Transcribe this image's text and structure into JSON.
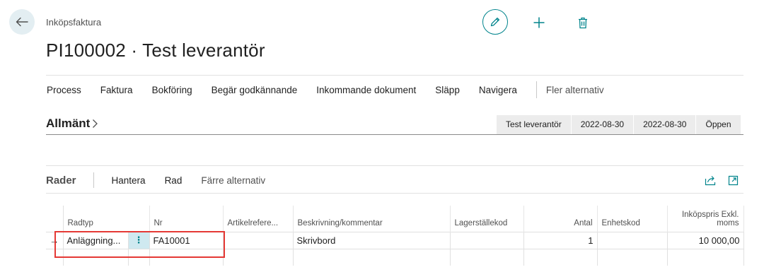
{
  "page": {
    "caption": "Inköpsfaktura",
    "title": "PI100002 · Test leverantör"
  },
  "actions": {
    "items": [
      "Process",
      "Faktura",
      "Bokföring",
      "Begär godkännande",
      "Inkommande dokument",
      "Släpp",
      "Navigera"
    ],
    "more": "Fler alternativ"
  },
  "general": {
    "title": "Allmänt",
    "summary": [
      "Test leverantör",
      "2022-08-30",
      "2022-08-30",
      "Öppen"
    ]
  },
  "lines": {
    "title": "Rader",
    "actions": [
      "Hantera",
      "Rad"
    ],
    "fewer": "Färre alternativ",
    "columns": {
      "type": "Radtyp",
      "no": "Nr",
      "itemref": "Artikelrefere...",
      "description": "Beskrivning/kommentar",
      "location": "Lagerställekod",
      "quantity": "Antal",
      "unit": "Enhetskod",
      "price": "Inköpspris Exkl. moms"
    },
    "rows": [
      {
        "indicator": "→",
        "type": "Anläggning...",
        "menu": "⋮",
        "no": "FA10001",
        "itemref": "",
        "description": "Skrivbord",
        "location": "",
        "quantity": "1",
        "unit": "",
        "price": "10 000,00"
      }
    ]
  },
  "colors": {
    "accent": "#00848c",
    "highlight": "#e53935",
    "chip_bg": "#ececec"
  }
}
